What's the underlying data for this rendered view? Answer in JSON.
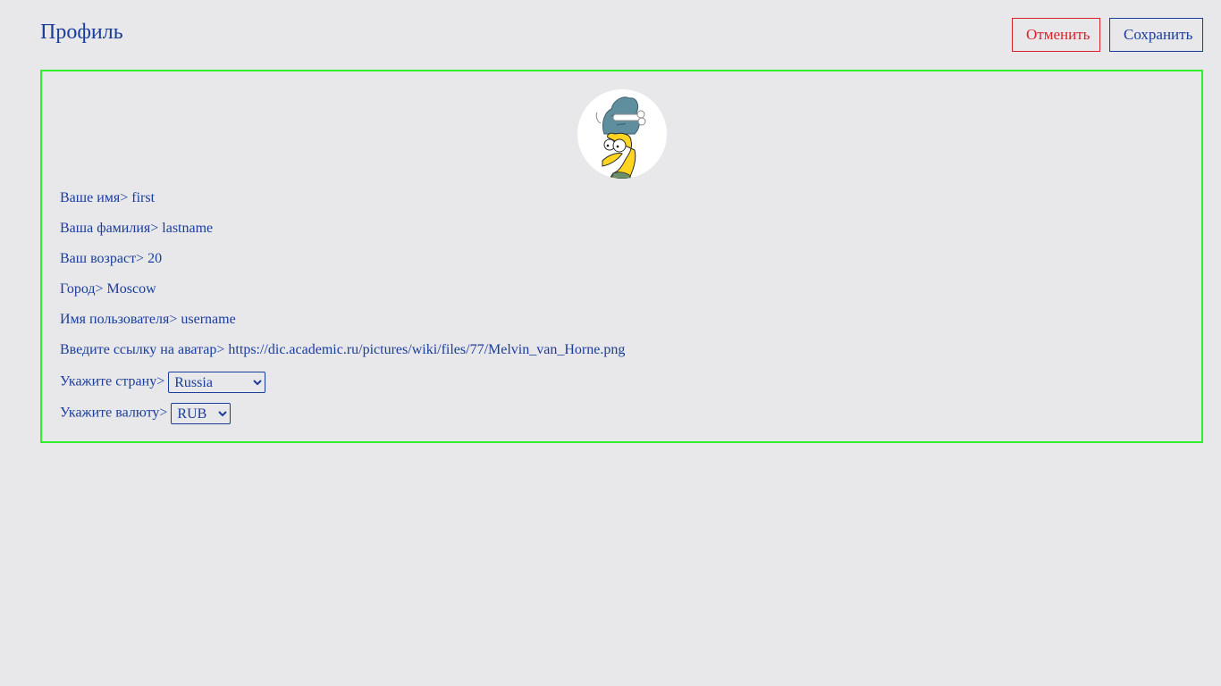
{
  "header": {
    "title": "Профиль",
    "cancel_label": "Отменить",
    "save_label": "Сохранить"
  },
  "colors": {
    "text": "#1a3d9c",
    "cancel": "#d8222a",
    "box_border": "#2ff02f",
    "background": "#e8e8eb"
  },
  "profile": {
    "avatar_icon": "avatar-cartoon-icon",
    "fields": [
      {
        "label": "Ваше имя> ",
        "value": "first"
      },
      {
        "label": "Ваша фамилия> ",
        "value": "lastname"
      },
      {
        "label": "Ваш возраст> ",
        "value": "20"
      },
      {
        "label": "Город> ",
        "value": "Moscow"
      },
      {
        "label": "Имя пользователя> ",
        "value": "username"
      },
      {
        "label": "Введите ссылку на аватар> ",
        "value": "https://dic.academic.ru/pictures/wiki/files/77/Melvin_van_Horne.png"
      }
    ],
    "country": {
      "label": "Укажите страну> ",
      "selected": "Russia"
    },
    "currency": {
      "label": "Укажите валюту> ",
      "selected": "RUB"
    }
  }
}
